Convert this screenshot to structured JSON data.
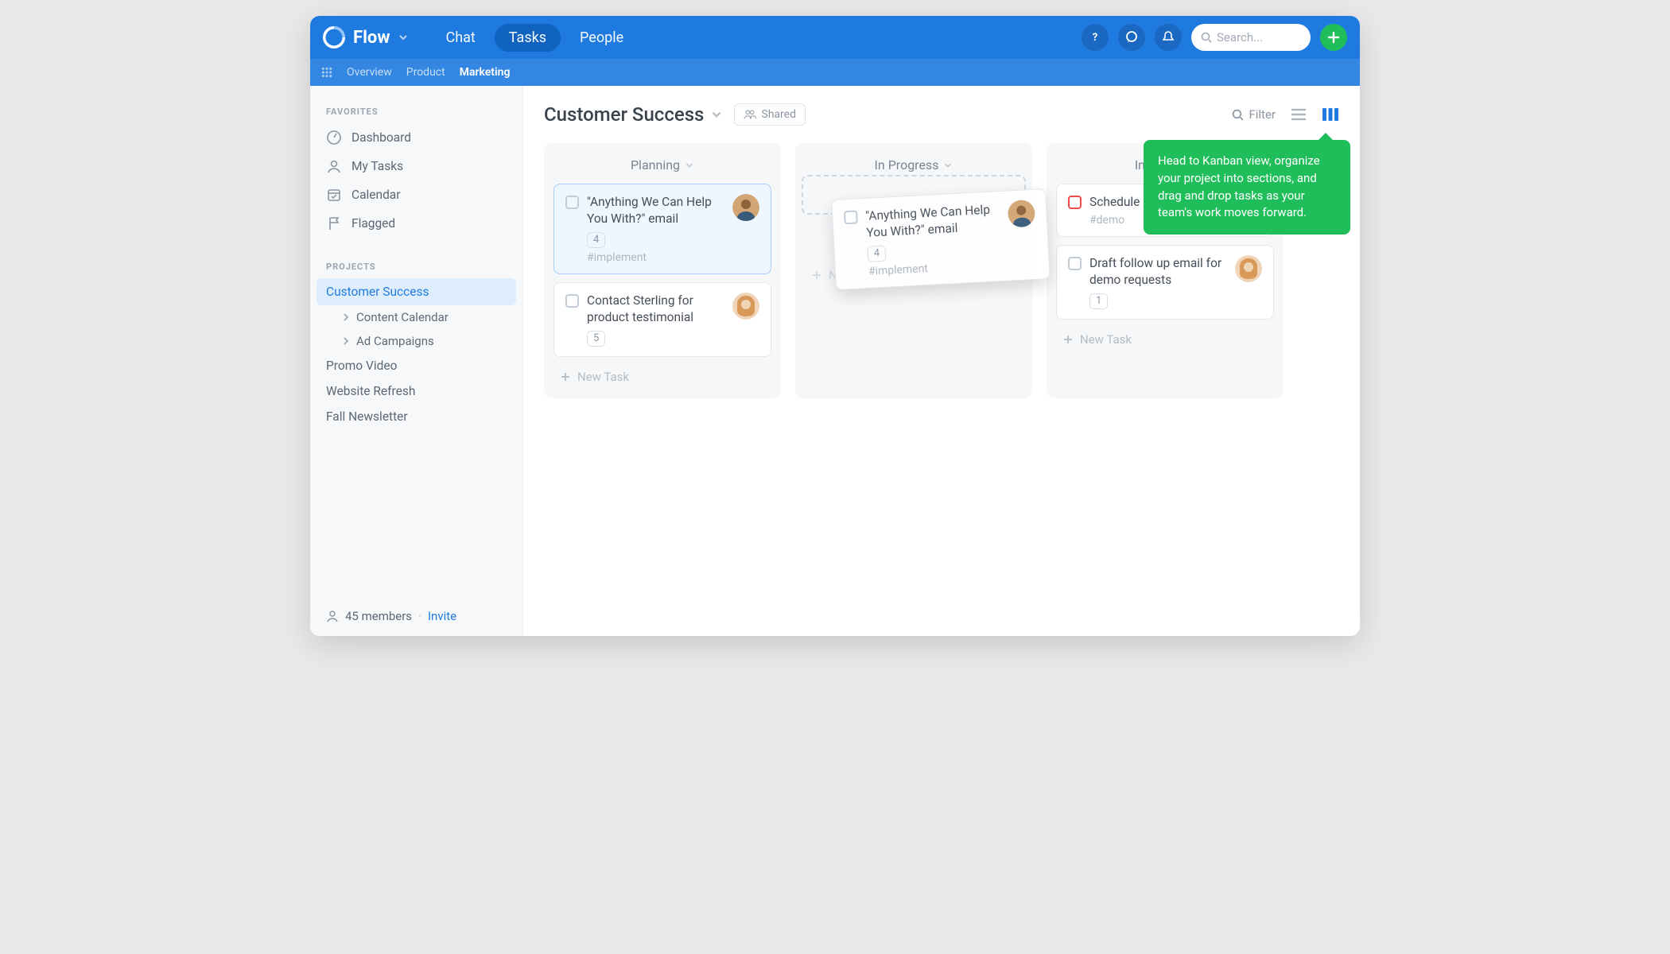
{
  "app": {
    "name": "Flow"
  },
  "nav": {
    "chat": "Chat",
    "tasks": "Tasks",
    "people": "People"
  },
  "search": {
    "placeholder": "Search..."
  },
  "subnav": {
    "overview": "Overview",
    "product": "Product",
    "marketing": "Marketing"
  },
  "sidebar": {
    "favorites_label": "FAVORITES",
    "favorites": {
      "dashboard": "Dashboard",
      "mytasks": "My Tasks",
      "calendar": "Calendar",
      "flagged": "Flagged"
    },
    "projects_label": "PROJECTS",
    "project_active": "Customer Success",
    "subprojects": {
      "content": "Content Calendar",
      "ads": "Ad Campaigns"
    },
    "other_projects": {
      "promo": "Promo Video",
      "website": "Website Refresh",
      "fall": "Fall Newsletter"
    },
    "footer": {
      "members": "45 members",
      "invite": "Invite"
    }
  },
  "main": {
    "title": "Customer Success",
    "shared": "Shared",
    "filter": "Filter",
    "new_task": "New Task",
    "columns": {
      "planning": "Planning",
      "progress": "In Progress",
      "implement": "Implement"
    },
    "cards": {
      "planning1": {
        "text": "\"Anything We Can Help You With?\" email",
        "count": "4",
        "tag": "#implement"
      },
      "planning2": {
        "text": "Contact Sterling for product testimonial",
        "count": "5"
      },
      "drag": {
        "text": "\"Anything We Can Help You With?\" email",
        "count": "4",
        "tag": "#implement"
      },
      "impl1": {
        "text": "Schedule a call with AK",
        "tag": "#demo"
      },
      "impl2": {
        "text": "Draft follow up email for demo requests",
        "count": "1"
      }
    }
  },
  "tooltip": "Head to Kanban view, organize your project into sections, and drag and drop tasks as your team's work moves forward."
}
